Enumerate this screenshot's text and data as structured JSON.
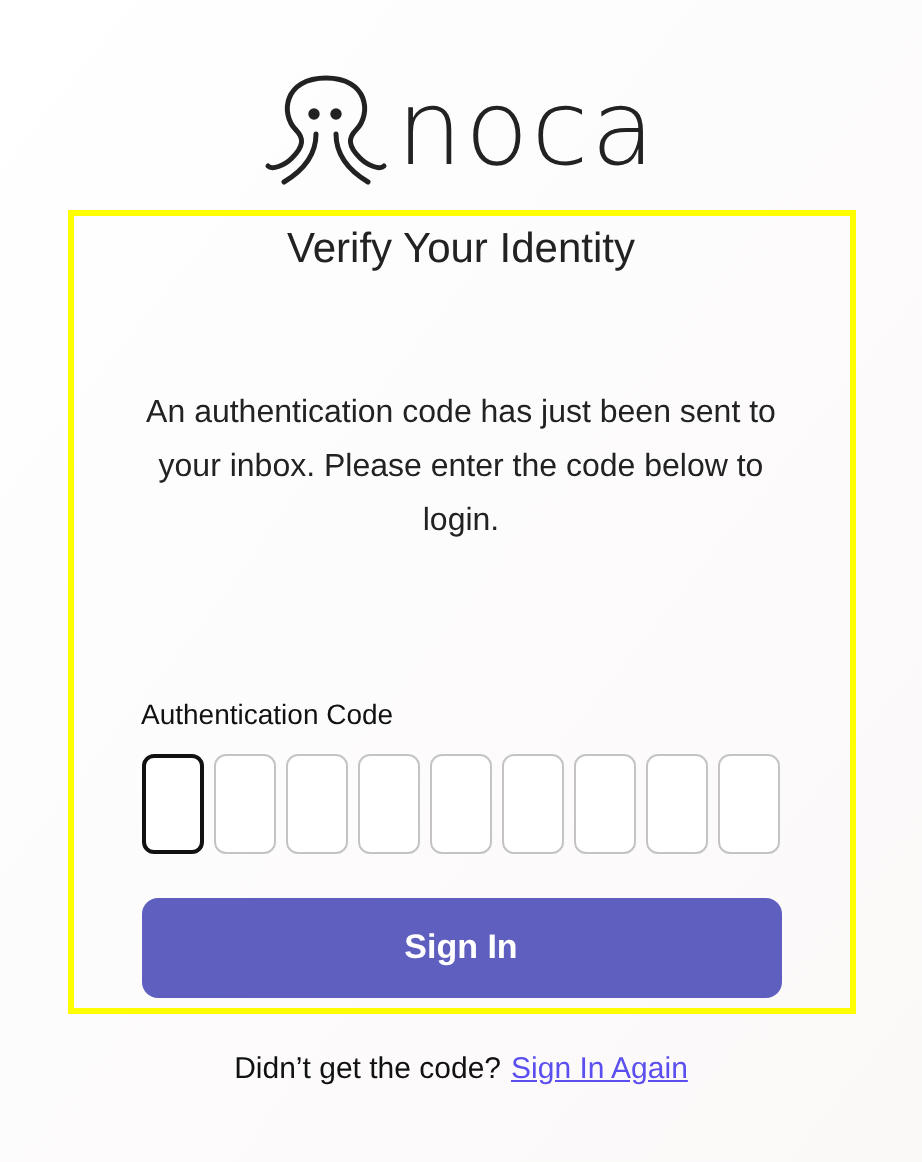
{
  "logo": {
    "wordmark": "noca"
  },
  "card": {
    "title": "Verify Your Identity",
    "message": "An authentication code has just been sent to your inbox. Please enter the code below to login.",
    "code_label": "Authentication Code",
    "code_boxes": [
      {
        "focused": true
      },
      {
        "focused": false
      },
      {
        "focused": false
      },
      {
        "focused": false
      },
      {
        "focused": false
      },
      {
        "focused": false
      },
      {
        "focused": false
      },
      {
        "focused": false
      },
      {
        "focused": false
      }
    ],
    "submit_button": "Sign In"
  },
  "footer": {
    "text": "Didn’t get the code?",
    "link": "Sign In Again"
  }
}
